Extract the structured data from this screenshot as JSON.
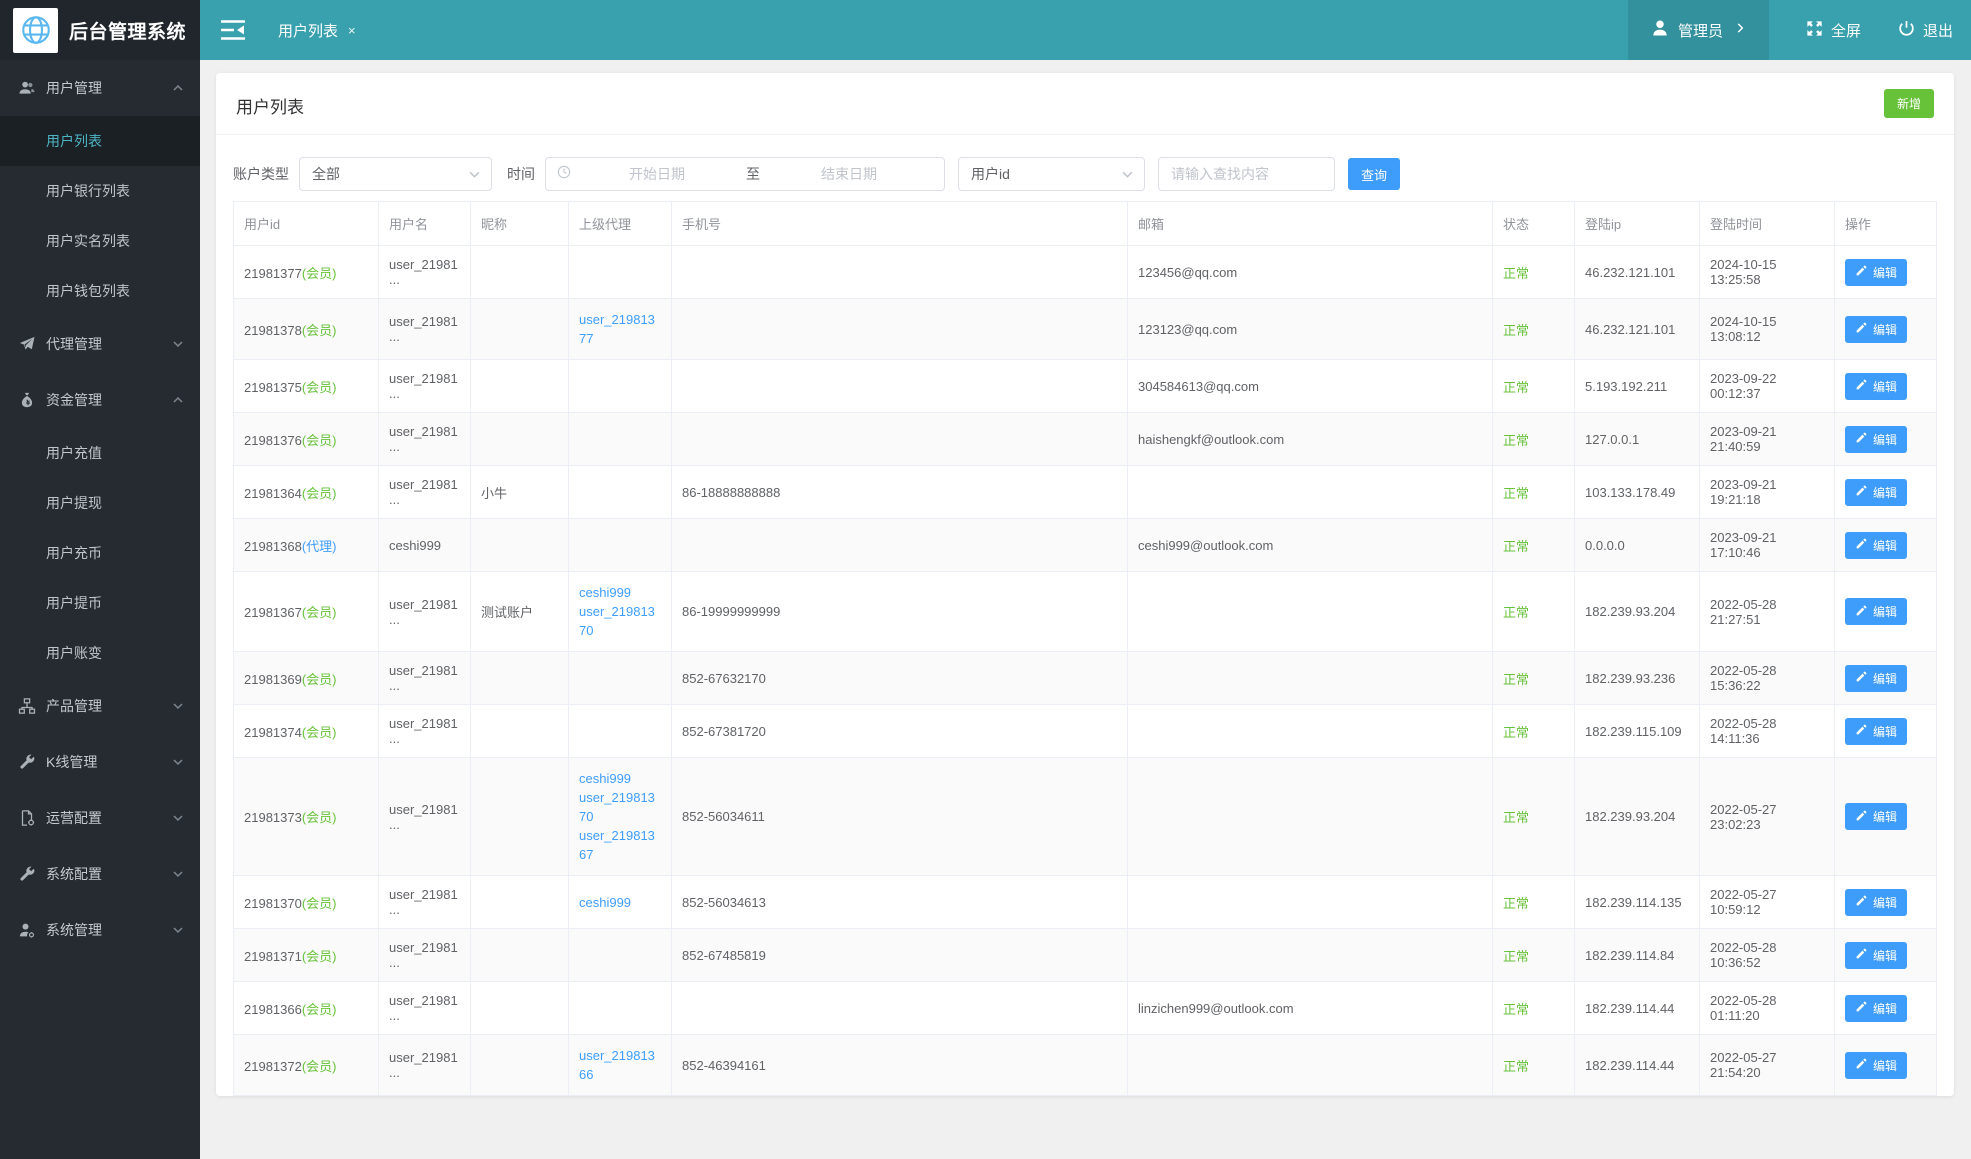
{
  "app": {
    "title": "后台管理系统"
  },
  "header": {
    "tab": "用户列表",
    "tab_close": "×",
    "admin_label": "管理员",
    "fullscreen_label": "全屏",
    "logout_label": "退出"
  },
  "sidebar": {
    "menu": [
      {
        "label": "用户管理",
        "icon": "users",
        "expanded": true,
        "children": [
          {
            "label": "用户列表",
            "active": true
          },
          {
            "label": "用户银行列表"
          },
          {
            "label": "用户实名列表"
          },
          {
            "label": "用户钱包列表"
          }
        ]
      },
      {
        "label": "代理管理",
        "icon": "paper-plane",
        "expanded": false,
        "children": []
      },
      {
        "label": "资金管理",
        "icon": "money-bag",
        "expanded": true,
        "children": [
          {
            "label": "用户充值"
          },
          {
            "label": "用户提现"
          },
          {
            "label": "用户充币"
          },
          {
            "label": "用户提币"
          },
          {
            "label": "用户账变"
          }
        ]
      },
      {
        "label": "产品管理",
        "icon": "sitemap",
        "expanded": false,
        "children": []
      },
      {
        "label": "K线管理",
        "icon": "wrench",
        "expanded": false,
        "children": []
      },
      {
        "label": "运营配置",
        "icon": "file-gear",
        "expanded": false,
        "children": []
      },
      {
        "label": "系统配置",
        "icon": "wrench",
        "expanded": false,
        "children": []
      },
      {
        "label": "系统管理",
        "icon": "user-gear",
        "expanded": false,
        "children": []
      }
    ]
  },
  "page": {
    "title": "用户列表",
    "add_button": "新增",
    "filters": {
      "account_type_label": "账户类型",
      "account_type_value": "全部",
      "time_label": "时间",
      "start_placeholder": "开始日期",
      "range_separator": "至",
      "end_placeholder": "结束日期",
      "field_value": "用户id",
      "search_placeholder": "请输入查找内容",
      "query_button": "查询"
    },
    "table": {
      "columns": [
        "用户id",
        "用户名",
        "昵称",
        "上级代理",
        "手机号",
        "邮箱",
        "状态",
        "登陆ip",
        "登陆时间",
        "操作"
      ],
      "edit_label": "编辑",
      "rows": [
        {
          "id": "21981377",
          "tag": "(会员)",
          "tag_type": "member",
          "username": "user_21981...",
          "nickname": "",
          "agents": [],
          "phone": "",
          "email": "123456@qq.com",
          "status": "正常",
          "ip": "46.232.121.101",
          "time": "2024-10-15 13:25:58"
        },
        {
          "id": "21981378",
          "tag": "(会员)",
          "tag_type": "member",
          "username": "user_21981...",
          "nickname": "",
          "agents": [
            "user_21981377"
          ],
          "phone": "",
          "email": "123123@qq.com",
          "status": "正常",
          "ip": "46.232.121.101",
          "time": "2024-10-15 13:08:12"
        },
        {
          "id": "21981375",
          "tag": "(会员)",
          "tag_type": "member",
          "username": "user_21981...",
          "nickname": "",
          "agents": [],
          "phone": "",
          "email": "304584613@qq.com",
          "status": "正常",
          "ip": "5.193.192.211",
          "time": "2023-09-22 00:12:37"
        },
        {
          "id": "21981376",
          "tag": "(会员)",
          "tag_type": "member",
          "username": "user_21981...",
          "nickname": "",
          "agents": [],
          "phone": "",
          "email": "haishengkf@outlook.com",
          "status": "正常",
          "ip": "127.0.0.1",
          "time": "2023-09-21 21:40:59"
        },
        {
          "id": "21981364",
          "tag": "(会员)",
          "tag_type": "member",
          "username": "user_21981...",
          "nickname": "小牛",
          "agents": [],
          "phone": "86-18888888888",
          "email": "",
          "status": "正常",
          "ip": "103.133.178.49",
          "time": "2023-09-21 19:21:18"
        },
        {
          "id": "21981368",
          "tag": "(代理)",
          "tag_type": "agent",
          "username": "ceshi999",
          "nickname": "",
          "agents": [],
          "phone": "",
          "email": "ceshi999@outlook.com",
          "status": "正常",
          "ip": "0.0.0.0",
          "time": "2023-09-21 17:10:46"
        },
        {
          "id": "21981367",
          "tag": "(会员)",
          "tag_type": "member",
          "username": "user_21981...",
          "nickname": "测试账户",
          "agents": [
            "ceshi999",
            "user_21981370"
          ],
          "phone": "86-19999999999",
          "email": "",
          "status": "正常",
          "ip": "182.239.93.204",
          "time": "2022-05-28 21:27:51"
        },
        {
          "id": "21981369",
          "tag": "(会员)",
          "tag_type": "member",
          "username": "user_21981...",
          "nickname": "",
          "agents": [],
          "phone": "852-67632170",
          "email": "",
          "status": "正常",
          "ip": "182.239.93.236",
          "time": "2022-05-28 15:36:22"
        },
        {
          "id": "21981374",
          "tag": "(会员)",
          "tag_type": "member",
          "username": "user_21981...",
          "nickname": "",
          "agents": [],
          "phone": "852-67381720",
          "email": "",
          "status": "正常",
          "ip": "182.239.115.109",
          "time": "2022-05-28 14:11:36"
        },
        {
          "id": "21981373",
          "tag": "(会员)",
          "tag_type": "member",
          "username": "user_21981...",
          "nickname": "",
          "agents": [
            "ceshi999",
            "user_21981370",
            "user_21981367"
          ],
          "phone": "852-56034611",
          "email": "",
          "status": "正常",
          "ip": "182.239.93.204",
          "time": "2022-05-27 23:02:23"
        },
        {
          "id": "21981370",
          "tag": "(会员)",
          "tag_type": "member",
          "username": "user_21981...",
          "nickname": "",
          "agents": [
            "ceshi999"
          ],
          "phone": "852-56034613",
          "email": "",
          "status": "正常",
          "ip": "182.239.114.135",
          "time": "2022-05-27 10:59:12"
        },
        {
          "id": "21981371",
          "tag": "(会员)",
          "tag_type": "member",
          "username": "user_21981...",
          "nickname": "",
          "agents": [],
          "phone": "852-67485819",
          "email": "",
          "status": "正常",
          "ip": "182.239.114.84",
          "time": "2022-05-28 10:36:52"
        },
        {
          "id": "21981366",
          "tag": "(会员)",
          "tag_type": "member",
          "username": "user_21981...",
          "nickname": "",
          "agents": [],
          "phone": "",
          "email": "linzichen999@outlook.com",
          "status": "正常",
          "ip": "182.239.114.44",
          "time": "2022-05-28 01:11:20"
        },
        {
          "id": "21981372",
          "tag": "(会员)",
          "tag_type": "member",
          "username": "user_21981...",
          "nickname": "",
          "agents": [
            "user_21981366"
          ],
          "phone": "852-46394161",
          "email": "",
          "status": "正常",
          "ip": "182.239.114.44",
          "time": "2022-05-27 21:54:20"
        }
      ]
    }
  },
  "colors": {
    "header_teal": "#39a0ae",
    "header_teal_dark": "#33909d",
    "sidebar_dark": "#252b31",
    "accent_blue": "#3e9cfa",
    "success_green": "#67c23a",
    "link_blue": "#3e9efc"
  },
  "icons": {
    "logo": "globe-icon",
    "menu": [
      "users-icon",
      "paper-plane-icon",
      "money-bag-icon",
      "sitemap-icon",
      "wrench-icon",
      "file-gear-icon",
      "wrench-icon",
      "user-gear-icon"
    ],
    "topbar": [
      "collapse-menu-icon",
      "user-icon",
      "chevron-right-icon",
      "fullscreen-icon",
      "power-icon"
    ],
    "filter": [
      "chevron-down-icon",
      "clock-icon"
    ],
    "table": [
      "pencil-icon"
    ]
  }
}
